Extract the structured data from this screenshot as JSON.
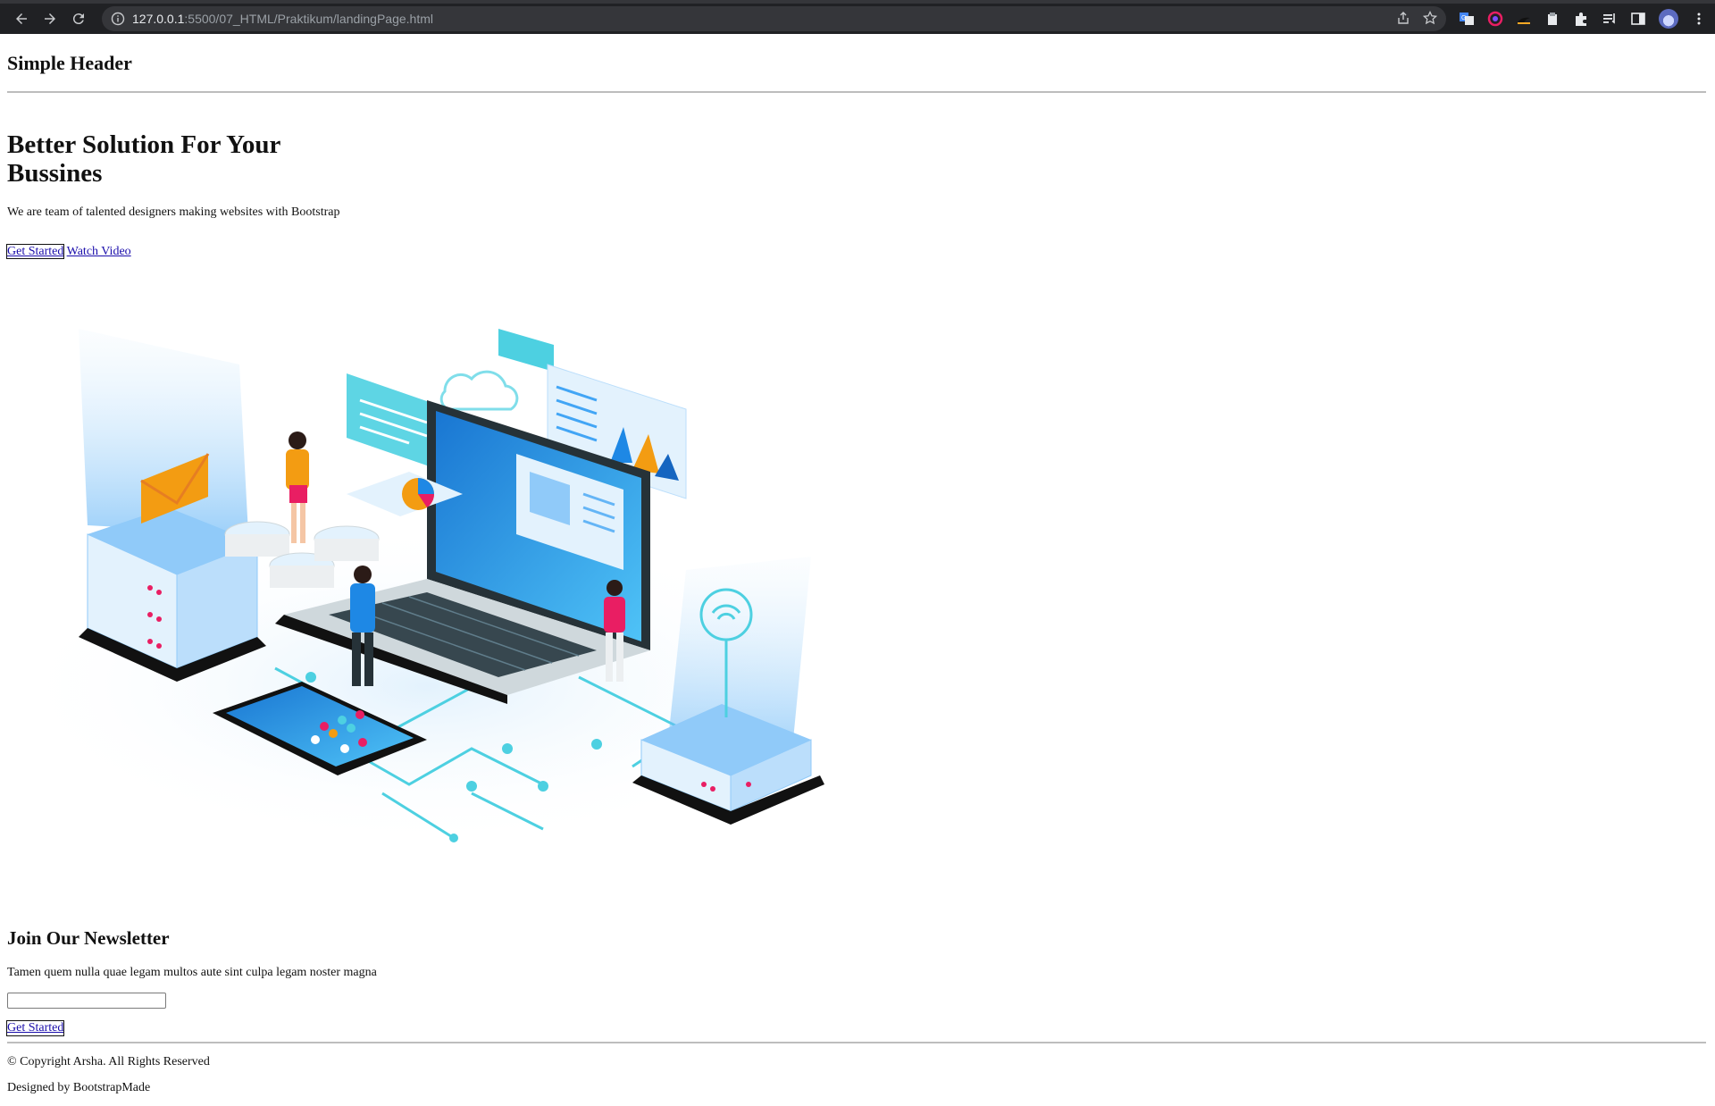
{
  "browser": {
    "url_host": "127.0.0.1",
    "url_path": ":5500/07_HTML/Praktikum/landingPage.html"
  },
  "header": {
    "title": "Simple Header"
  },
  "hero": {
    "title": "Better Solution For Your Bussines",
    "subtitle": "We are team of talented designers making websites with Bootstrap",
    "primary_link": "Get Started",
    "secondary_link": "Watch Video"
  },
  "newsletter": {
    "title": "Join Our Newsletter",
    "text": "Tamen quem nulla quae legam multos aute sint culpa legam noster magna",
    "input_value": "",
    "button": "Get Started"
  },
  "footer": {
    "copyright": "© Copyright Arsha. All Rights Reserved",
    "designed_by": "Designed by BootstrapMade"
  },
  "colors": {
    "chrome_bg": "#202124",
    "omnibox_bg": "#35363a",
    "link": "#1a0dab",
    "illustration_blue": "#1e88e5",
    "illustration_cyan": "#4dd0e1",
    "illustration_orange": "#f39c12"
  }
}
